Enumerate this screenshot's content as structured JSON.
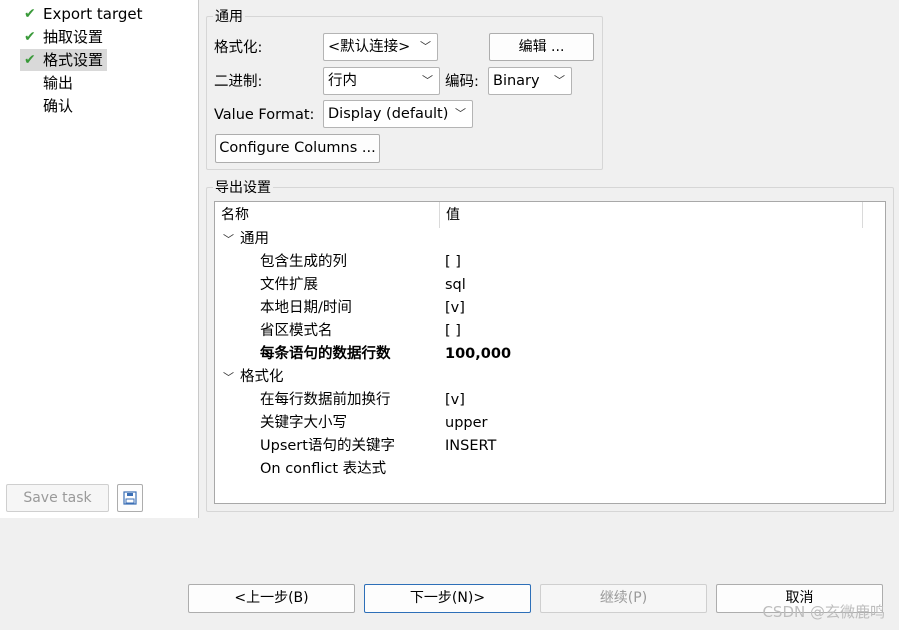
{
  "nav": {
    "items": [
      {
        "label": "Export target",
        "checked": true,
        "selected": false
      },
      {
        "label": "抽取设置",
        "checked": true,
        "selected": false
      },
      {
        "label": "格式设置",
        "checked": true,
        "selected": true
      },
      {
        "label": "输出",
        "checked": false,
        "selected": false
      },
      {
        "label": "确认",
        "checked": false,
        "selected": false
      }
    ],
    "save_task_label": "Save task",
    "save_icon": "save-task-icon"
  },
  "general": {
    "title": "通用",
    "format_label": "格式化:",
    "format_value": "<默认连接>",
    "edit_button": "编辑 ...",
    "binary_label": "二进制:",
    "binary_value": "行内",
    "encoding_label": "编码:",
    "encoding_value": "Binary",
    "value_format_label": "Value Format:",
    "value_format_value": "Display (default)",
    "configure_columns_button": "Configure Columns ..."
  },
  "export_settings": {
    "title": "导出设置",
    "columns": [
      "名称",
      "值"
    ],
    "groups": [
      {
        "name": "通用",
        "rows": [
          {
            "name": "包含生成的列",
            "value": "[ ]",
            "bold": false
          },
          {
            "name": "文件扩展",
            "value": "sql",
            "bold": false
          },
          {
            "name": "本地日期/时间",
            "value": "[v]",
            "bold": false
          },
          {
            "name": "省区模式名",
            "value": "[ ]",
            "bold": false
          },
          {
            "name": "每条语句的数据行数",
            "value": "100,000",
            "bold": true
          }
        ]
      },
      {
        "name": "格式化",
        "rows": [
          {
            "name": "在每行数据前加换行",
            "value": "[v]",
            "bold": false
          },
          {
            "name": "关键字大小写",
            "value": "upper",
            "bold": false
          },
          {
            "name": "Upsert语句的关键字",
            "value": "INSERT",
            "bold": false
          },
          {
            "name": "On conflict 表达式",
            "value": "",
            "bold": false
          }
        ]
      }
    ]
  },
  "footer": {
    "back_label": "<上一步(B)",
    "next_label": "下一步(N)>",
    "continue_label": "继续(P)",
    "cancel_label": "取消"
  },
  "watermark": "CSDN @玄微鹿鸣",
  "colors": {
    "check": "#3a9a3a",
    "selection": "#d9d9d9",
    "focus_border": "#2d6fb8"
  }
}
